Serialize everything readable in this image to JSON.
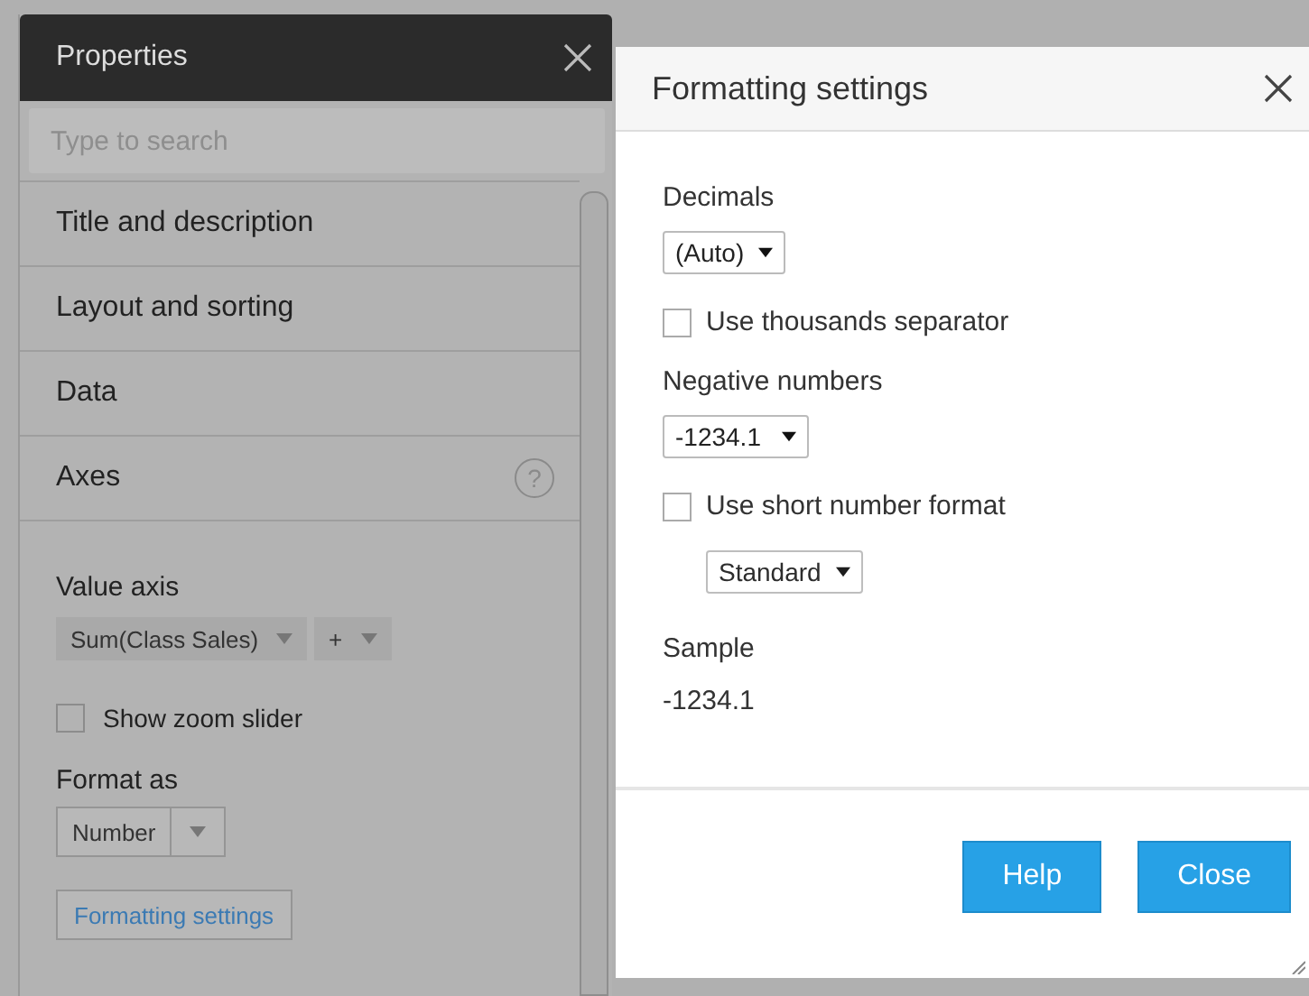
{
  "properties_panel": {
    "title": "Properties",
    "search": {
      "placeholder": "Type to search"
    },
    "sections": [
      {
        "label": "Title and description"
      },
      {
        "label": "Layout and sorting"
      },
      {
        "label": "Data"
      },
      {
        "label": "Axes",
        "help": "?"
      }
    ],
    "value_axis": {
      "label": "Value axis",
      "measure": "Sum(Class Sales)",
      "add": "+"
    },
    "zoom_slider": {
      "label": "Show zoom slider",
      "checked": false
    },
    "format_as": {
      "label": "Format as",
      "value": "Number"
    },
    "formatting_button": "Formatting settings"
  },
  "dialog": {
    "title": "Formatting settings",
    "decimals": {
      "label": "Decimals",
      "value": "(Auto)"
    },
    "thousands": {
      "label": "Use thousands separator",
      "checked": false
    },
    "negative": {
      "label": "Negative numbers",
      "value": "-1234.1"
    },
    "short_format": {
      "label": "Use short number format",
      "checked": false,
      "value": "Standard"
    },
    "sample": {
      "label": "Sample",
      "value": "-1234.1"
    },
    "buttons": [
      "Help",
      "Close"
    ]
  }
}
